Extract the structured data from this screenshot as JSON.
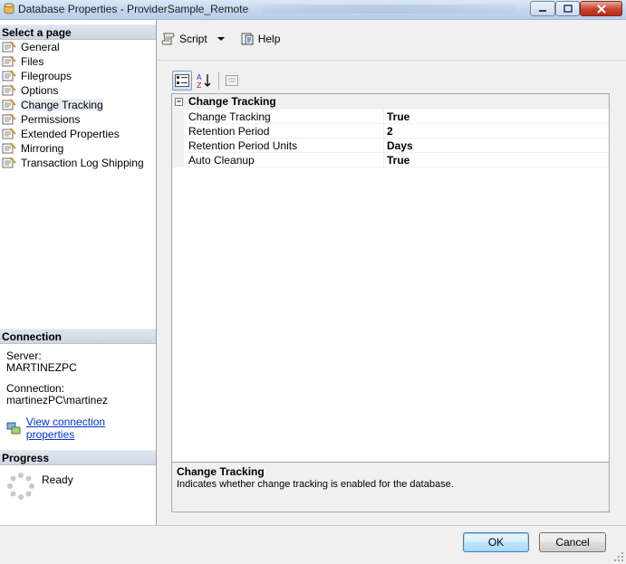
{
  "window": {
    "title": "Database Properties - ProviderSample_Remote"
  },
  "left_pane": {
    "select_page_header": "Select a page",
    "pages": [
      {
        "label": "General",
        "selected": false
      },
      {
        "label": "Files",
        "selected": false
      },
      {
        "label": "Filegroups",
        "selected": false
      },
      {
        "label": "Options",
        "selected": false
      },
      {
        "label": "Change Tracking",
        "selected": true
      },
      {
        "label": "Permissions",
        "selected": false
      },
      {
        "label": "Extended Properties",
        "selected": false
      },
      {
        "label": "Mirroring",
        "selected": false
      },
      {
        "label": "Transaction Log Shipping",
        "selected": false
      }
    ],
    "connection_header": "Connection",
    "server_label": "Server:",
    "server_value": "MARTINEZPC",
    "connection_label": "Connection:",
    "connection_value": "martinezPC\\martinez",
    "view_connection_link": "View connection properties",
    "progress_header": "Progress",
    "progress_status": "Ready"
  },
  "toolbar": {
    "script_label": "Script",
    "help_label": "Help"
  },
  "property_grid": {
    "category": "Change Tracking",
    "properties": [
      {
        "name": "Change Tracking",
        "value": "True"
      },
      {
        "name": "Retention Period",
        "value": "2"
      },
      {
        "name": "Retention Period Units",
        "value": "Days"
      },
      {
        "name": "Auto Cleanup",
        "value": "True"
      }
    ]
  },
  "description": {
    "title": "Change Tracking",
    "text": "Indicates whether change tracking is enabled for the database."
  },
  "buttons": {
    "ok_label": "OK",
    "cancel_label": "Cancel"
  }
}
